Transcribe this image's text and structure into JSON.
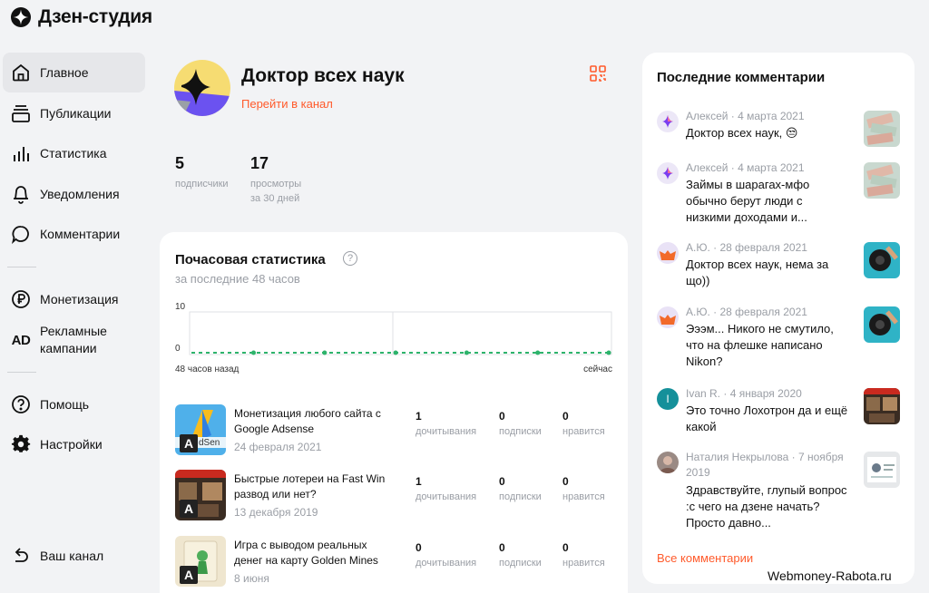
{
  "app": {
    "title": "Дзен-студия"
  },
  "nav": {
    "items": [
      {
        "label": "Главное",
        "icon": "home-icon",
        "active": true
      },
      {
        "label": "Публикации",
        "icon": "publications-icon"
      },
      {
        "label": "Статистика",
        "icon": "stats-bars-icon"
      },
      {
        "label": "Уведомления",
        "icon": "bell-icon"
      },
      {
        "label": "Комментарии",
        "icon": "comment-bubble-icon"
      },
      {
        "label": "Монетизация",
        "icon": "ruble-icon"
      },
      {
        "label": "Рекламные кампании",
        "icon": "ad-icon",
        "icon_text": "AD"
      },
      {
        "label": "Помощь",
        "icon": "help-icon"
      },
      {
        "label": "Настройки",
        "icon": "gear-icon"
      },
      {
        "label": "Ваш канал",
        "icon": "exit-icon"
      }
    ]
  },
  "channel": {
    "name": "Доктор всех наук",
    "link_label": "Перейти в канал",
    "subscribers": {
      "value": "5",
      "label": "подписчики"
    },
    "views": {
      "value": "17",
      "label": "просмотры",
      "sub_label": "за 30 дней"
    }
  },
  "hourly_stats": {
    "title": "Почасовая статистика",
    "help_mark": "?",
    "subtitle": "за последние 48 часов",
    "axis_left": "48 часов назад",
    "axis_right": "сейчас",
    "y_max_label": "10",
    "y_min_label": "0"
  },
  "chart_data": {
    "type": "line",
    "x": [
      "48 часов назад",
      "сейчас"
    ],
    "y_ticks": [
      0,
      10
    ],
    "ylim": [
      0,
      10
    ],
    "series": [
      {
        "values": [
          0,
          0,
          0,
          0,
          0,
          0,
          0,
          0,
          0,
          0,
          0,
          0,
          0,
          0,
          0,
          0,
          0,
          0,
          0,
          0,
          0,
          0,
          0,
          0,
          0,
          0,
          0,
          0,
          0,
          0,
          0,
          0,
          0,
          0,
          0,
          0,
          0,
          0,
          0,
          0,
          0,
          0,
          0,
          0,
          0,
          0,
          0,
          0
        ]
      }
    ],
    "color": "#2db36b"
  },
  "publications": [
    {
      "title": "Монетизация любого сайта с Google Adsense",
      "date": "24 февраля 2021",
      "reads": "1",
      "reads_label": "дочитывания",
      "subs": "0",
      "subs_label": "подписки",
      "likes": "0",
      "likes_label": "нравится",
      "badge": "A"
    },
    {
      "title": "Быстрые лотереи на Fast Win развод или нет?",
      "date": "13 декабря 2019",
      "reads": "1",
      "reads_label": "дочитывания",
      "subs": "0",
      "subs_label": "подписки",
      "likes": "0",
      "likes_label": "нравится",
      "badge": "A"
    },
    {
      "title": "Игра с выводом реальных денег на карту Golden Mines",
      "date": "8 июня",
      "reads": "0",
      "reads_label": "дочитывания",
      "subs": "0",
      "subs_label": "подписки",
      "likes": "0",
      "likes_label": "нравится",
      "badge": "A"
    }
  ],
  "comments": {
    "title": "Последние комментарии",
    "all_label": "Все комментарии",
    "items": [
      {
        "author": "Алексей",
        "date": "4 марта 2021",
        "text": "Доктор всех наук, 😒"
      },
      {
        "author": "Алексей",
        "date": "4 марта 2021",
        "text": "Займы в шарагах-мфо обычно берут люди с низкими доходами и..."
      },
      {
        "author": "А.Ю.",
        "date": "28 февраля 2021",
        "text": "Доктор всех наук, нема за що))"
      },
      {
        "author": "А.Ю.",
        "date": "28 февраля 2021",
        "text": "Эээм... Никого не смутило, что на флешке написано Nikon?"
      },
      {
        "author": "Ivan R.",
        "date": "4 января 2020",
        "text": "Это точно Лохотрон да и ещё какой",
        "avatar_letter": "I"
      },
      {
        "author": "Наталия Некрылова",
        "date": "7 ноября 2019",
        "text": "Здравствуйте, глупый вопрос :с чего на дзене начать? Просто давно..."
      }
    ]
  },
  "watermark": "Webmoney-Rabota.ru",
  "colors": {
    "accent": "#ff5a2b",
    "chart": "#2db36b",
    "muted": "#9a9ea5"
  }
}
